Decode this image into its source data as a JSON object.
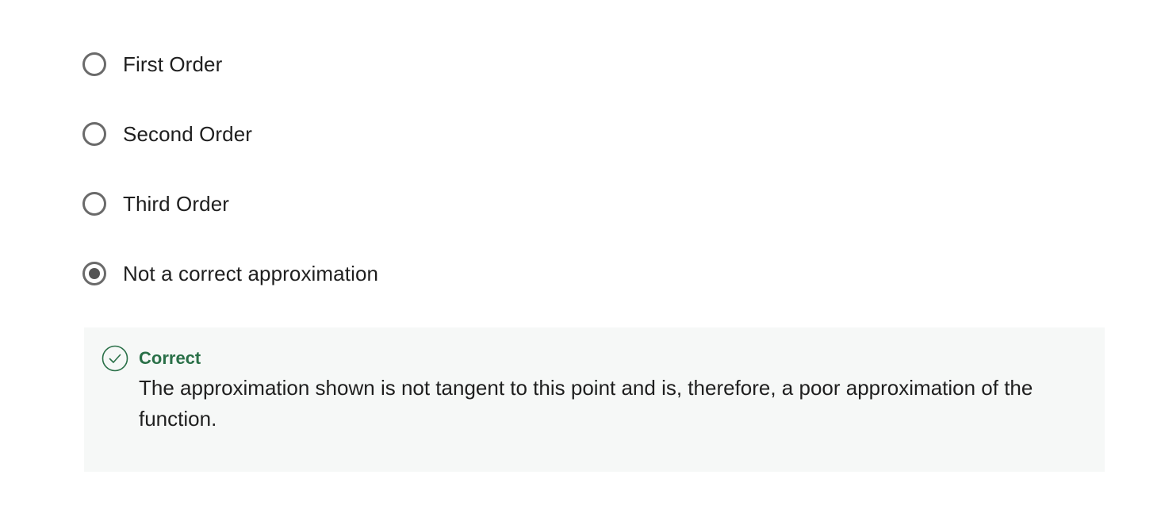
{
  "options": [
    {
      "label": "First Order",
      "selected": false
    },
    {
      "label": "Second Order",
      "selected": false
    },
    {
      "label": "Third Order",
      "selected": false
    },
    {
      "label": "Not a correct approximation",
      "selected": true
    }
  ],
  "feedback": {
    "status": "Correct",
    "message": "The approximation shown is not tangent to this point and is, therefore, a poor approximation of the function.",
    "icon": "check-circle-icon",
    "status_color": "#2a7048"
  },
  "colors": {
    "radio_border": "#6a6a6a",
    "radio_fill": "#555555",
    "feedback_background": "#f6f8f7"
  }
}
